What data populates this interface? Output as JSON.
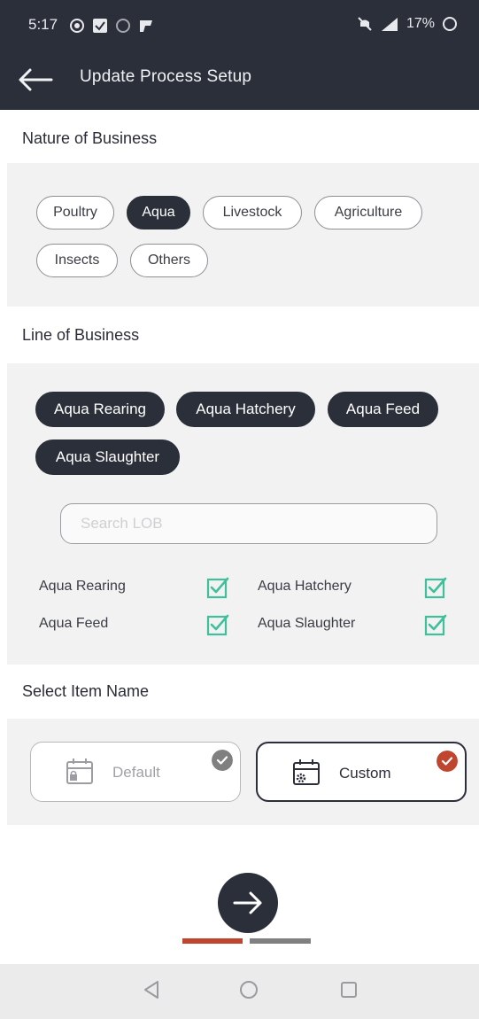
{
  "status_bar": {
    "time": "5:17",
    "battery": "17%"
  },
  "app_bar": {
    "title": "Update Process Setup"
  },
  "nature_of_business": {
    "label": "Nature of Business",
    "options": [
      {
        "label": "Poultry",
        "selected": false
      },
      {
        "label": "Aqua",
        "selected": true
      },
      {
        "label": "Livestock",
        "selected": false
      },
      {
        "label": "Agriculture",
        "selected": false
      },
      {
        "label": "Insects",
        "selected": false
      },
      {
        "label": "Others",
        "selected": false
      }
    ]
  },
  "line_of_business": {
    "label": "Line of Business",
    "selected_chips": [
      "Aqua Rearing",
      "Aqua Hatchery",
      "Aqua Feed",
      "Aqua Slaughter"
    ],
    "search_placeholder": "Search LOB",
    "checklist": [
      {
        "label": "Aqua Rearing",
        "checked": true
      },
      {
        "label": "Aqua Hatchery",
        "checked": true
      },
      {
        "label": "Aqua Feed",
        "checked": true
      },
      {
        "label": "Aqua Slaughter",
        "checked": true
      }
    ]
  },
  "select_item_name": {
    "label": "Select Item Name",
    "options": [
      {
        "label": "Default",
        "selected": false
      },
      {
        "label": "Custom",
        "selected": true
      }
    ]
  },
  "step_progress": {
    "current": 1,
    "total": 2
  },
  "colors": {
    "primary_dark": "#2b2f3a",
    "accent_red": "#c0452f",
    "check_green": "#3fbf9a",
    "inactive_gray": "#808080",
    "panel_bg": "#f2f2f2"
  }
}
